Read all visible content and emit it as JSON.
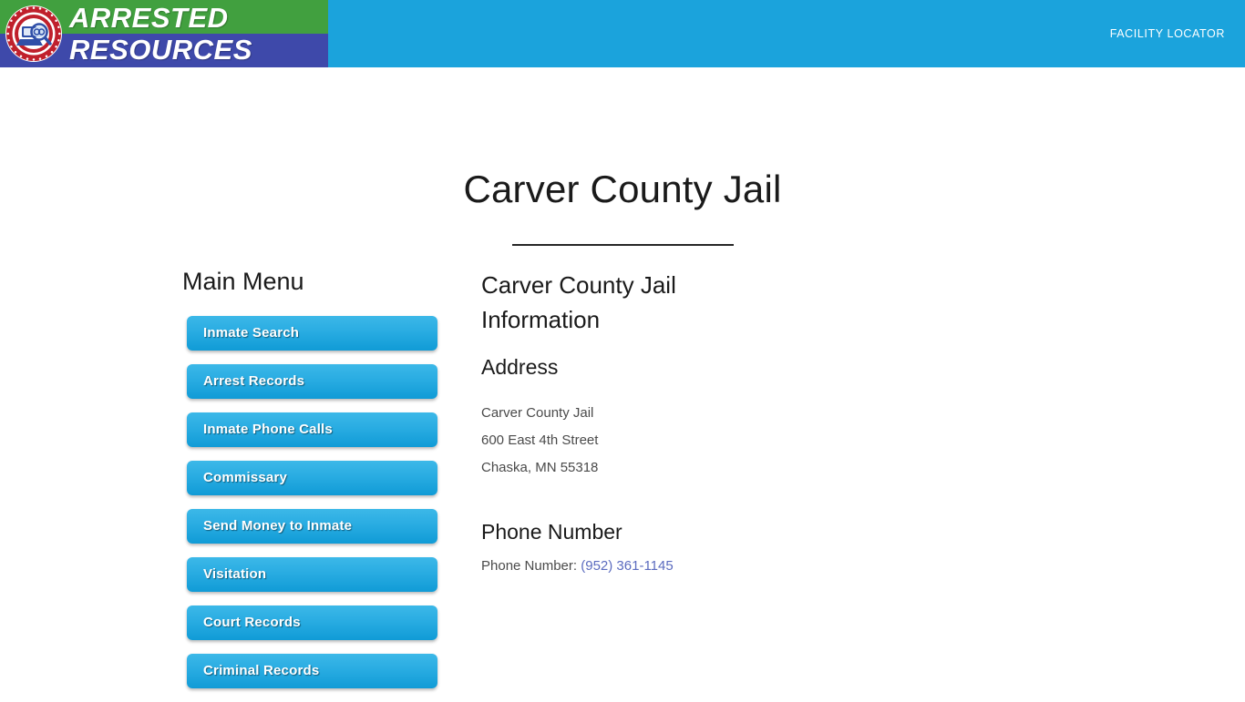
{
  "header": {
    "brand": {
      "line1": "ARRESTED",
      "line2": "RESOURCES",
      "seal_icon": "arrested-resources-seal-icon",
      "seal_ring_text": "ARRESTED RESOURCES",
      "green": "#41a03f",
      "indigo": "#3e49aa"
    },
    "bar_color": "#1ba3dc",
    "nav": {
      "facility_locator": "FACILITY LOCATOR"
    }
  },
  "page": {
    "title": "Carver County Jail"
  },
  "menu": {
    "heading": "Main Menu",
    "items": [
      {
        "label": "Inmate Search"
      },
      {
        "label": "Arrest Records"
      },
      {
        "label": "Inmate Phone Calls"
      },
      {
        "label": "Commissary"
      },
      {
        "label": "Send Money to Inmate"
      },
      {
        "label": "Visitation"
      },
      {
        "label": "Court Records"
      },
      {
        "label": "Criminal Records"
      }
    ],
    "button_gradient_top": "#3cb8e8",
    "button_gradient_bottom": "#109bd6"
  },
  "info": {
    "heading": "Carver County Jail Information",
    "address_heading": "Address",
    "address": {
      "line1": "Carver County Jail",
      "line2": "600 East 4th Street",
      "line3": "Chaska, MN 55318"
    },
    "phone_heading": "Phone Number",
    "phone_label": "Phone Number:",
    "phone_value": "(952) 361-1145",
    "phone_link_color": "#5b6bbf"
  }
}
